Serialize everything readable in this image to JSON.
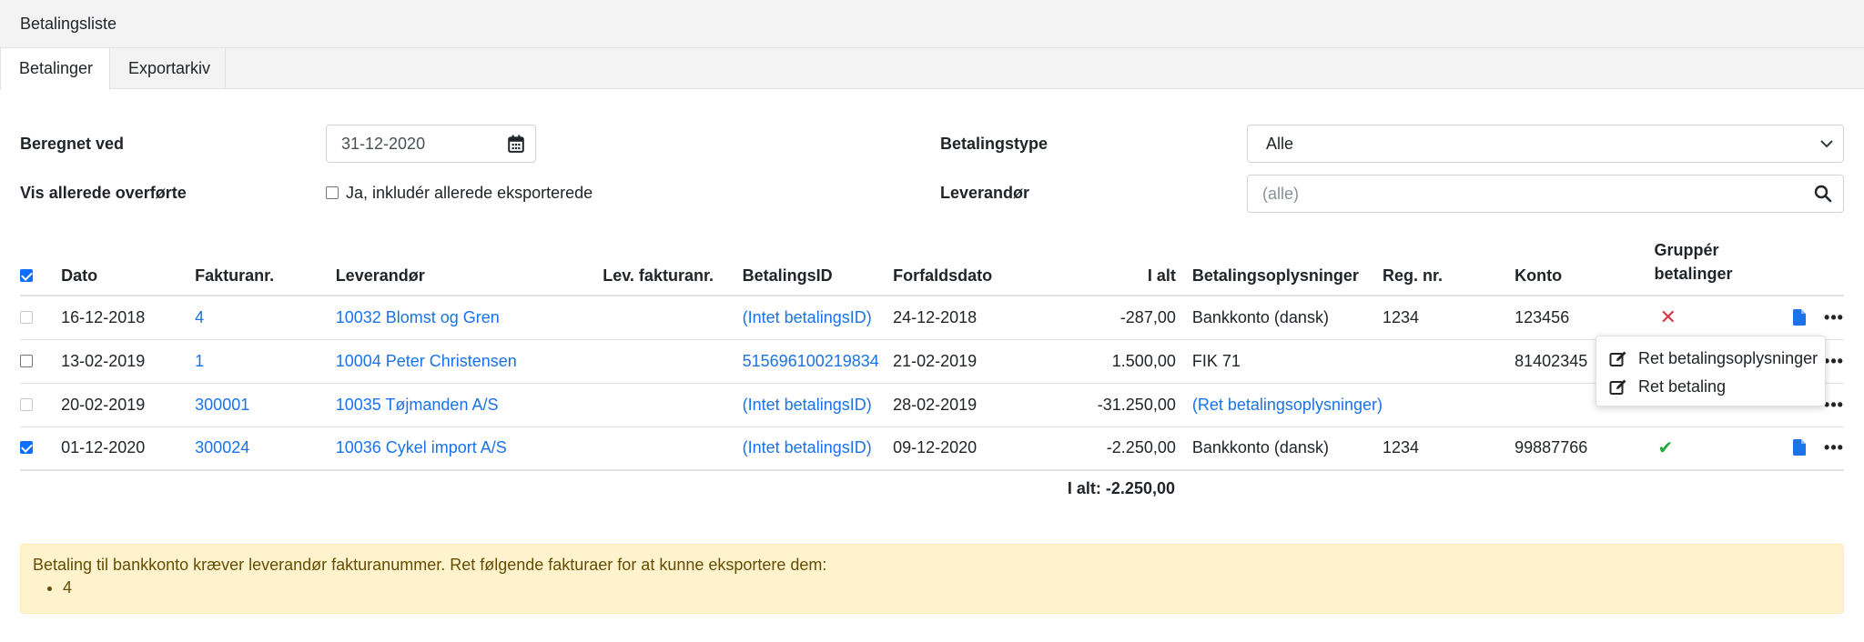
{
  "window": {
    "title": "Betalingsliste"
  },
  "tabs": [
    {
      "label": "Betalinger",
      "active": true
    },
    {
      "label": "Exportarkiv",
      "active": false
    }
  ],
  "filters": {
    "calc_label": "Beregnet ved",
    "calc_date": "31-12-2020",
    "show_label": "Vis allerede overførte",
    "show_checkbox_label": "Ja, inkludér allerede eksporterede",
    "show_checked": false,
    "paytype_label": "Betalingstype",
    "paytype_value": "Alle",
    "supplier_label": "Leverandør",
    "supplier_placeholder": "(alle)"
  },
  "table": {
    "columns": [
      "Dato",
      "Fakturanr.",
      "Leverandør",
      "Lev. fakturanr.",
      "BetalingsID",
      "Forfaldsdato",
      "I alt",
      "Betalingsoplysninger",
      "Reg. nr.",
      "Konto",
      "Gruppér betalinger"
    ],
    "rows": [
      {
        "checked": false,
        "disabled": true,
        "dato": "16-12-2018",
        "fakturanr": "4",
        "leverandor": "10032 Blomst og Gren",
        "lev_fakturanr": "",
        "betalingsid": "(Intet betalingsID)",
        "forfaldsdato": "24-12-2018",
        "ialt": "-287,00",
        "betalingsoplysninger": "Bankkonto (dansk)",
        "betalingsoplysninger_link": false,
        "regnr": "1234",
        "konto": "123456",
        "group_status": "invalid"
      },
      {
        "checked": false,
        "disabled": false,
        "dato": "13-02-2019",
        "fakturanr": "1",
        "leverandor": "10004 Peter Christensen",
        "lev_fakturanr": "",
        "betalingsid": "515696100219834",
        "forfaldsdato": "21-02-2019",
        "ialt": "1.500,00",
        "betalingsoplysninger": "FIK 71",
        "betalingsoplysninger_link": false,
        "regnr": "",
        "konto": "81402345",
        "group_status": "none"
      },
      {
        "checked": false,
        "disabled": true,
        "dato": "20-02-2019",
        "fakturanr": "300001",
        "leverandor": "10035 Tøjmanden A/S",
        "lev_fakturanr": "",
        "betalingsid": "(Intet betalingsID)",
        "forfaldsdato": "28-02-2019",
        "ialt": "-31.250,00",
        "betalingsoplysninger": "(Ret betalingsoplysninger)",
        "betalingsoplysninger_link": true,
        "regnr": "",
        "konto": "",
        "group_status": "none"
      },
      {
        "checked": true,
        "disabled": false,
        "dato": "01-12-2020",
        "fakturanr": "300024",
        "leverandor": "10036 Cykel import A/S",
        "lev_fakturanr": "",
        "betalingsid": "(Intet betalingsID)",
        "forfaldsdato": "09-12-2020",
        "ialt": "-2.250,00",
        "betalingsoplysninger": "Bankkonto (dansk)",
        "betalingsoplysninger_link": false,
        "regnr": "1234",
        "konto": "99887766",
        "group_status": "valid"
      }
    ],
    "total_label": "I alt: -2.250,00"
  },
  "context_menu": {
    "items": [
      {
        "label": "Ret betalingsoplysninger",
        "icon": "edit-icon"
      },
      {
        "label": "Ret betaling",
        "icon": "edit-icon"
      }
    ]
  },
  "alert": {
    "message": "Betaling til bankkonto kræver leverandør fakturanummer. Ret følgende fakturaer for at kunne eksportere dem:",
    "items": [
      "4"
    ]
  },
  "colors": {
    "link": "#1a73e8",
    "danger": "#dc3545",
    "success": "#28a745",
    "warning_bg": "#fff3cd"
  }
}
